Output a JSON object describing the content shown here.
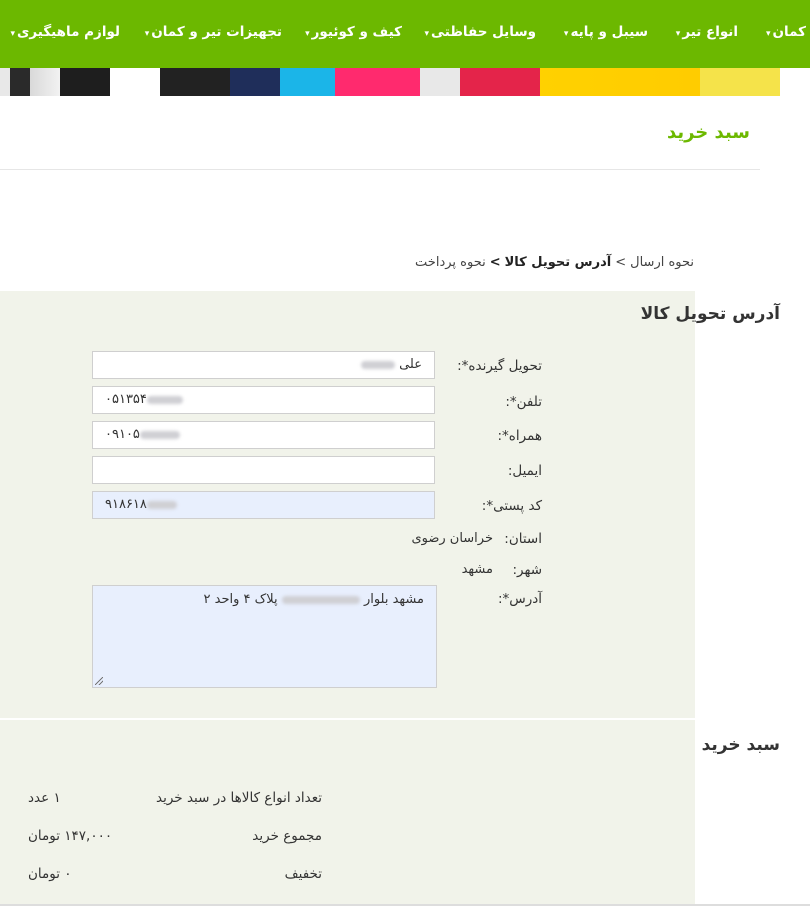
{
  "nav": {
    "items": [
      {
        "label": "کمان"
      },
      {
        "label": "انواع تیر"
      },
      {
        "label": "سیبل و پایه"
      },
      {
        "label": "وسایل حفاظتی"
      },
      {
        "label": "کیف و کوئیور"
      },
      {
        "label": "تجهیزات تیر و کمان"
      },
      {
        "label": "لوازم ماهیگیری"
      }
    ],
    "caret": "▾"
  },
  "page": {
    "title": "سبد خرید"
  },
  "breadcrumb": {
    "step1": "نحوه ارسال",
    "sep1": ">",
    "step2": "آدرس تحویل کالا",
    "sep2": ">",
    "step3": "نحوه پرداخت"
  },
  "address": {
    "heading": "آدرس تحویل کالا",
    "recipient_label": "تحویل گیرنده*:",
    "recipient_value": "علی",
    "phone_label": "تلفن*:",
    "phone_value": "۰۵۱۳۵۴",
    "mobile_label": "همراه*:",
    "mobile_value": "۰۹۱۰۵",
    "email_label": "ایمیل:",
    "email_value": "",
    "postal_label": "کد پستی*:",
    "postal_value": "۹۱۸۶۱۸",
    "province_label": "استان:",
    "province_value": "خراسان رضوی",
    "city_label": "شهر:",
    "city_value": "مشهد",
    "addr_label": "آدرس*:",
    "addr_value_start": "مشهد بلوار",
    "addr_value_end": "پلاک ۴ واحد ۲"
  },
  "cart": {
    "heading": "سبد خرید",
    "rows": [
      {
        "label": "تعداد انواع کالاها در سبد خرید",
        "value": "۱ عدد"
      },
      {
        "label": "مجموع خرید",
        "value": "۱۴۷,۰۰۰ تومان"
      },
      {
        "label": "تخفیف",
        "value": "۰ تومان"
      }
    ]
  },
  "colors": {
    "brand_green": "#6cb800",
    "panel_bg": "#f1f3ea",
    "autofill_bg": "#e8effd"
  }
}
